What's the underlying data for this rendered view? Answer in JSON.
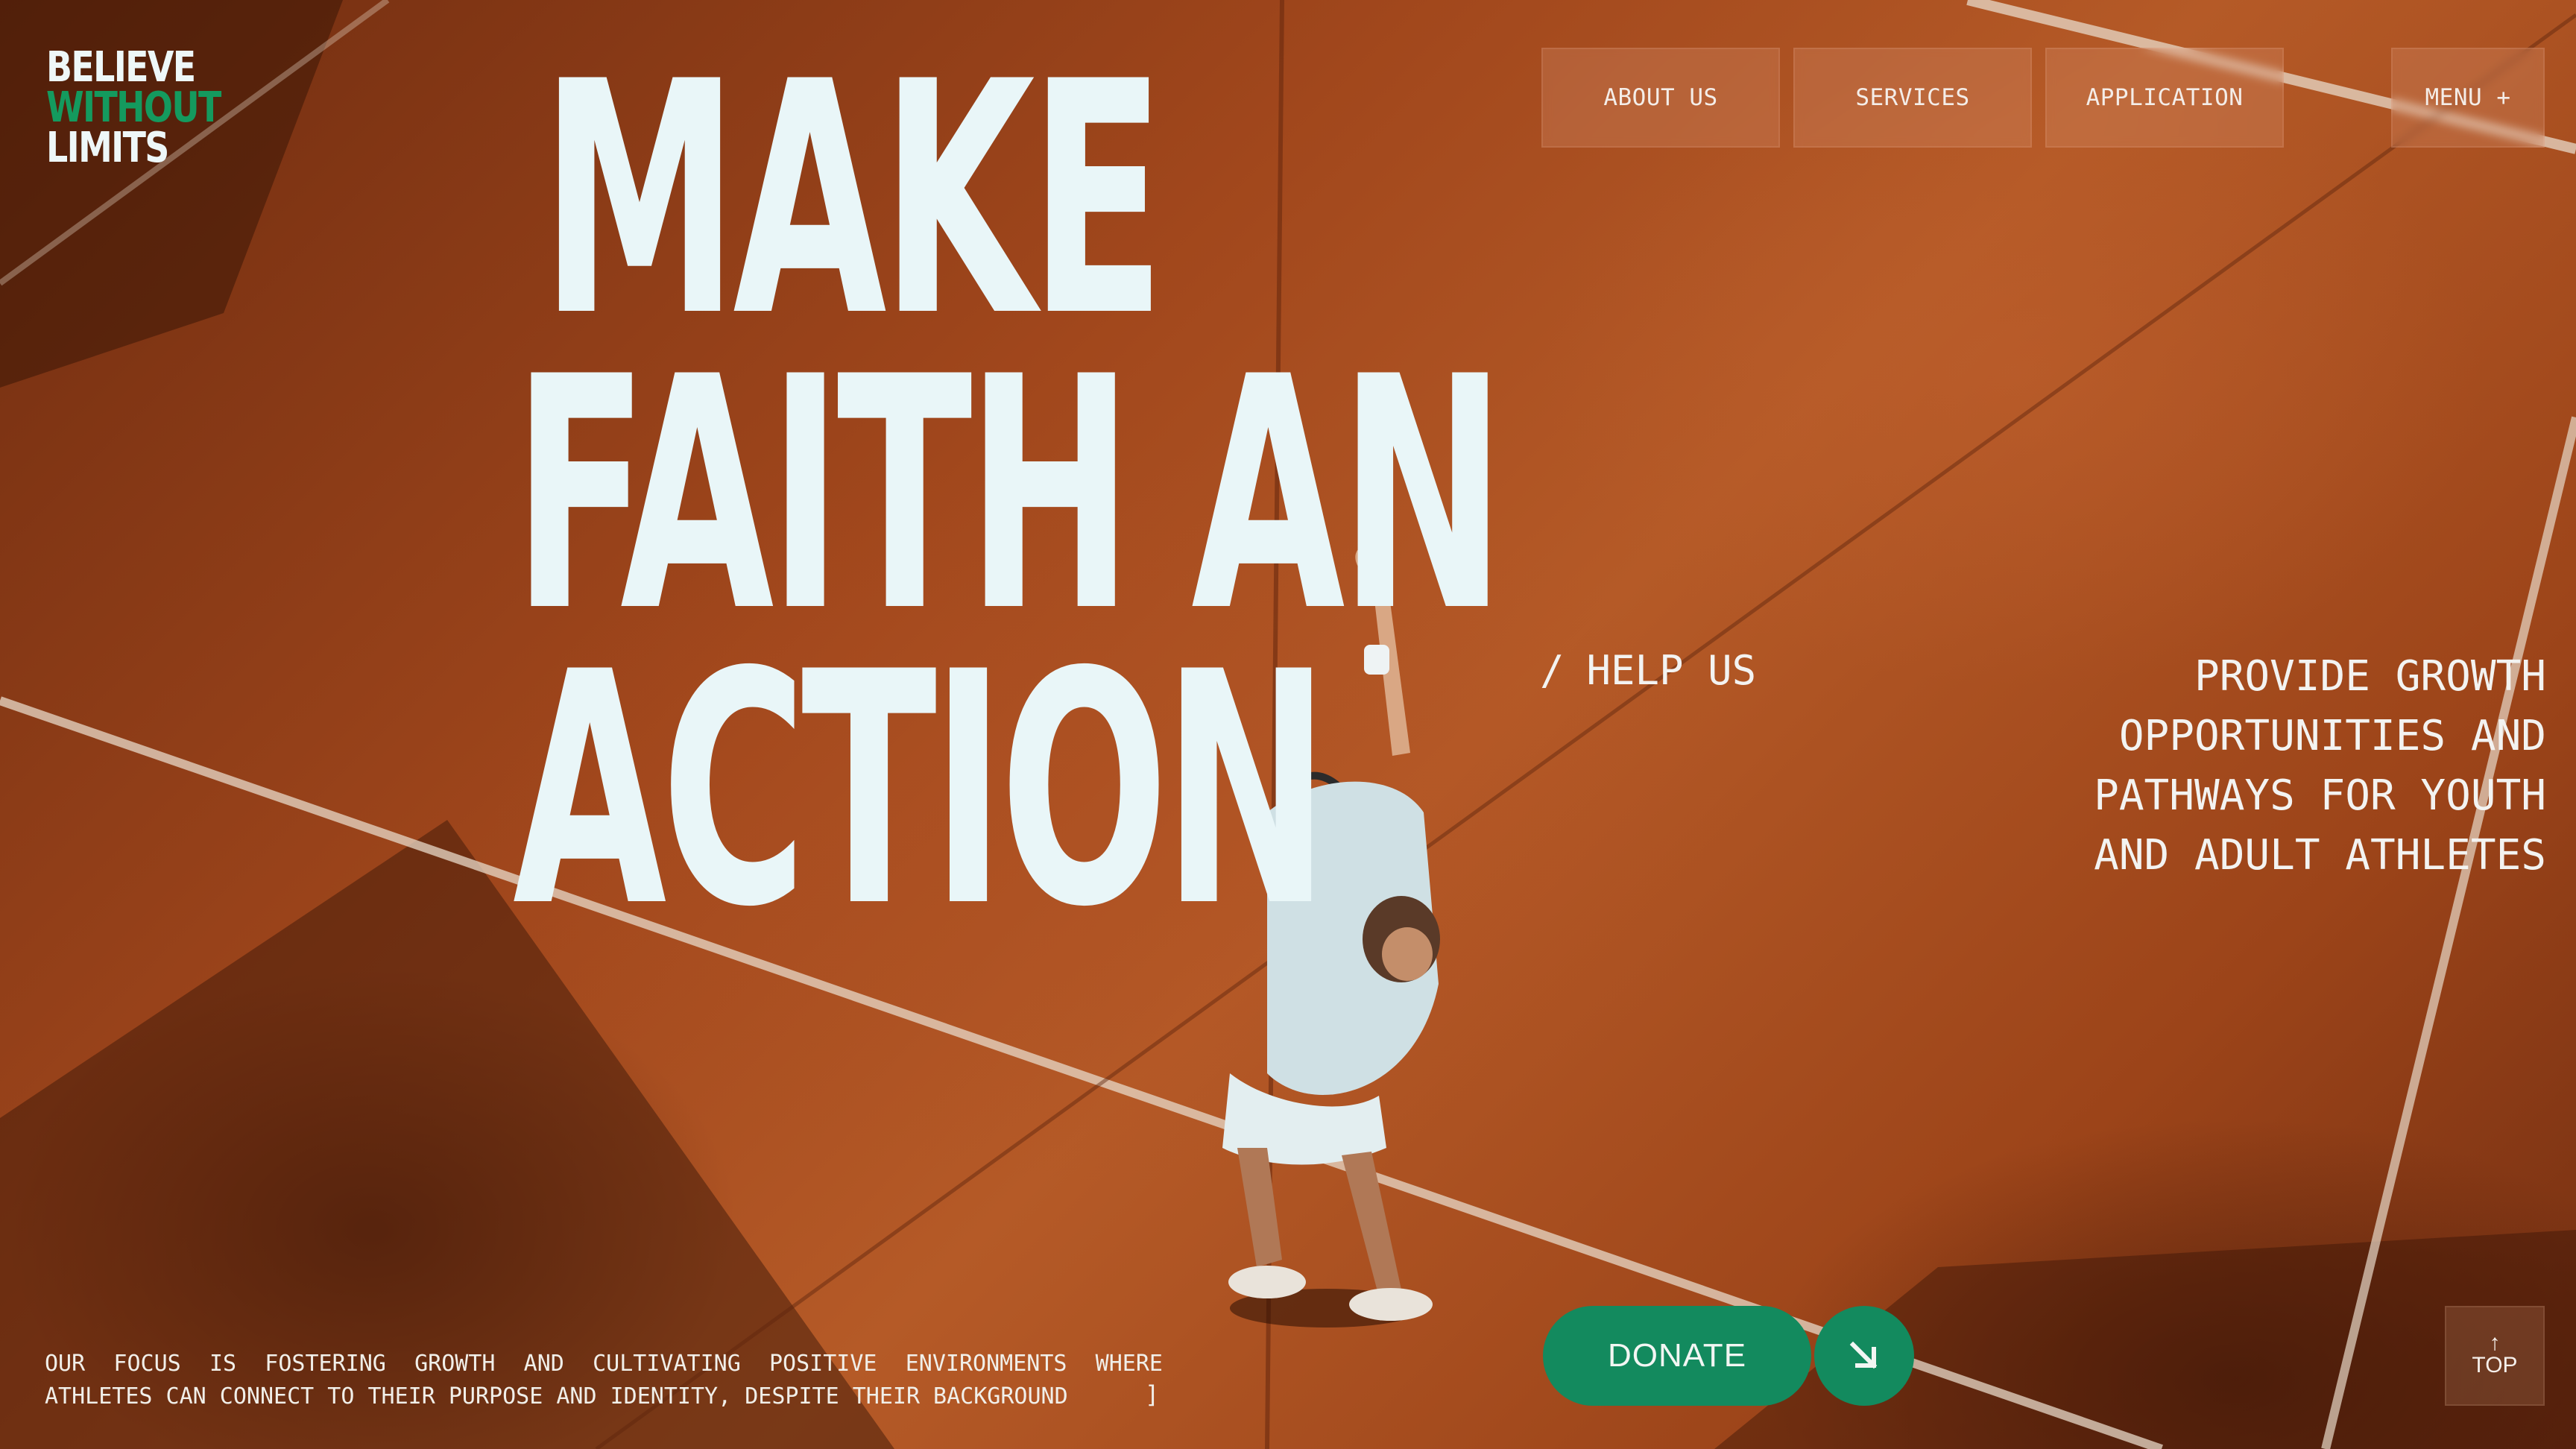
{
  "brand": {
    "line1": "BELIEVE",
    "line2": "WITHOUT",
    "line3": "LIMITS",
    "accent_color": "#149a5e"
  },
  "headline": {
    "line1": "MAKE",
    "line2": "FAITH AN",
    "line3": "ACTION"
  },
  "nav": {
    "about": "ABOUT US",
    "services": "SERVICES",
    "application": "APPLICATION",
    "menu": "MENU +"
  },
  "help": {
    "slash": "/",
    "label": "HELP US"
  },
  "mission": "PROVIDE GROWTH OPPORTUNITIES AND PATHWAYS FOR YOUTH AND ADULT ATHLETES",
  "focus": {
    "line1": "OUR FOCUS IS FOSTERING GROWTH AND CULTIVATING POSITIVE ENVIRONMENTS WHERE",
    "line2": "ATHLETES CAN CONNECT TO THEIR PURPOSE AND IDENTITY, DESPITE THEIR BACKGROUND",
    "bracket": "]"
  },
  "donate": {
    "label": "DONATE",
    "icon": "arrow-down-right-icon",
    "color": "#138a5e"
  },
  "top": {
    "arrow": "↑",
    "label": "TOP"
  }
}
